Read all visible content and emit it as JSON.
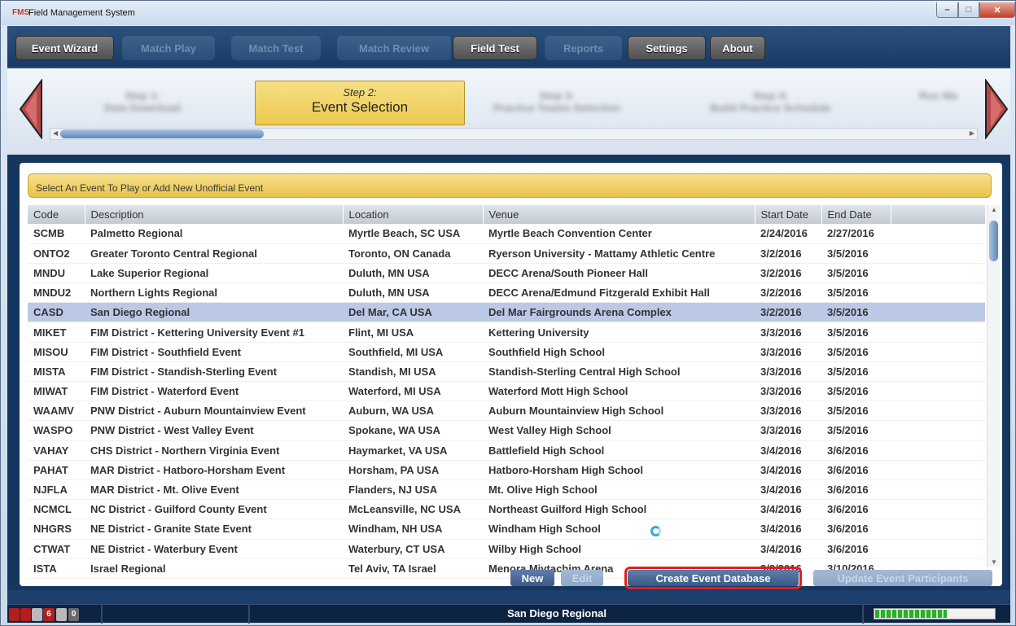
{
  "window": {
    "title": "Field Management System",
    "min": "–",
    "max": "□",
    "close": "✕"
  },
  "menu": {
    "tabs": [
      {
        "label": "Event Wizard",
        "enabled": true
      },
      {
        "label": "Match Play",
        "enabled": false
      },
      {
        "label": "Match Test",
        "enabled": false
      },
      {
        "label": "Match Review",
        "enabled": false
      },
      {
        "label": "Field Test",
        "enabled": true
      },
      {
        "label": "Reports",
        "enabled": false
      },
      {
        "label": "Settings",
        "enabled": true
      },
      {
        "label": "About",
        "enabled": true
      }
    ]
  },
  "wizard": {
    "current_step_number": "Step 2:",
    "current_step_name": "Event Selection",
    "other_steps": [
      {
        "number": "Step 1:",
        "name": "Data Download"
      },
      {
        "number": "Step 3:",
        "name": "Practice Teams Selection"
      },
      {
        "number": "Step 4:",
        "name": "Build Practice Schedule"
      },
      {
        "number": "",
        "name": "Run Ma"
      }
    ]
  },
  "prompt": "Select An Event To Play or Add New Unofficial Event",
  "table": {
    "columns": [
      "Code",
      "Description",
      "Location",
      "Venue",
      "Start Date",
      "End Date"
    ],
    "selected_index": 4,
    "rows": [
      [
        "SCMB",
        "Palmetto Regional",
        "Myrtle Beach, SC USA",
        "Myrtle Beach Convention Center",
        "2/24/2016",
        "2/27/2016"
      ],
      [
        "ONTO2",
        "Greater Toronto Central Regional",
        "Toronto, ON Canada",
        "Ryerson University - Mattamy Athletic Centre",
        "3/2/2016",
        "3/5/2016"
      ],
      [
        "MNDU",
        "Lake Superior Regional",
        "Duluth, MN USA",
        "DECC Arena/South Pioneer Hall",
        "3/2/2016",
        "3/5/2016"
      ],
      [
        "MNDU2",
        "Northern Lights Regional",
        "Duluth, MN USA",
        "DECC Arena/Edmund Fitzgerald Exhibit Hall",
        "3/2/2016",
        "3/5/2016"
      ],
      [
        "CASD",
        "San Diego Regional",
        "Del Mar, CA USA",
        "Del Mar Fairgrounds Arena Complex",
        "3/2/2016",
        "3/5/2016"
      ],
      [
        "MIKET",
        "FIM District - Kettering University Event #1",
        "Flint, MI USA",
        "Kettering University",
        "3/3/2016",
        "3/5/2016"
      ],
      [
        "MISOU",
        "FIM District - Southfield Event",
        "Southfield, MI USA",
        "Southfield High School",
        "3/3/2016",
        "3/5/2016"
      ],
      [
        "MISTA",
        "FIM District - Standish-Sterling Event",
        "Standish, MI USA",
        "Standish-Sterling Central High School",
        "3/3/2016",
        "3/5/2016"
      ],
      [
        "MIWAT",
        "FIM District - Waterford Event",
        "Waterford, MI USA",
        "Waterford Mott High School",
        "3/3/2016",
        "3/5/2016"
      ],
      [
        "WAAMV",
        "PNW District - Auburn Mountainview Event",
        "Auburn, WA USA",
        "Auburn Mountainview High School",
        "3/3/2016",
        "3/5/2016"
      ],
      [
        "WASPO",
        "PNW District - West Valley Event",
        "Spokane, WA USA",
        "West Valley High School",
        "3/3/2016",
        "3/5/2016"
      ],
      [
        "VAHAY",
        "CHS District - Northern Virginia Event",
        "Haymarket, VA USA",
        "Battlefield High School",
        "3/4/2016",
        "3/6/2016"
      ],
      [
        "PAHAT",
        "MAR District - Hatboro-Horsham Event",
        "Horsham, PA USA",
        "Hatboro-Horsham High School",
        "3/4/2016",
        "3/6/2016"
      ],
      [
        "NJFLA",
        "MAR District - Mt. Olive Event",
        "Flanders, NJ USA",
        "Mt. Olive High School",
        "3/4/2016",
        "3/6/2016"
      ],
      [
        "NCMCL",
        "NC District - Guilford County Event",
        "McLeansville, NC USA",
        "Northeast Guilford High School",
        "3/4/2016",
        "3/6/2016"
      ],
      [
        "NHGRS",
        "NE District - Granite State Event",
        "Windham, NH USA",
        "Windham High School",
        "3/4/2016",
        "3/6/2016"
      ],
      [
        "CTWAT",
        "NE District - Waterbury Event",
        "Waterbury, CT USA",
        "Wilby High School",
        "3/4/2016",
        "3/6/2016"
      ],
      [
        "ISTA",
        "Israel Regional",
        "Tel Aviv, TA Israel",
        "Menora Mivtachim Arena",
        "3/8/2016",
        "3/10/2016"
      ]
    ]
  },
  "actions": {
    "new": "New",
    "edit": "Edit",
    "create": "Create Event Database",
    "update": "Update Event Participants"
  },
  "status": {
    "count_a": "6",
    "count_b": "0",
    "event_name": "San Diego Regional",
    "progress": 0.6
  },
  "colors": {
    "accent": "#1d3f6b",
    "highlight": "#e02020",
    "selected_row": "#bcc9e6"
  }
}
